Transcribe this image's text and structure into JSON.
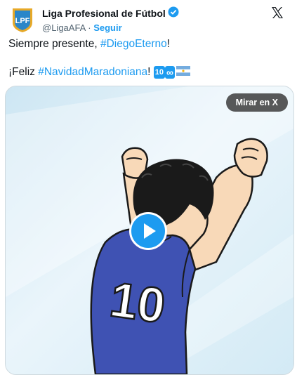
{
  "account": {
    "display_name": "Liga Profesional de Fútbol",
    "handle": "@LigaAFA",
    "separator": "·",
    "follow_label": "Seguir",
    "logo_text": "LPF"
  },
  "tweet": {
    "line1_text": "Siempre presente, ",
    "line1_hashtag": "#DiegoEterno",
    "line1_end": "!",
    "line2_text": "¡Feliz ",
    "line2_hashtag": "#NavidadMaradoniana",
    "line2_end": "! ",
    "emoji_ten": "10",
    "emoji_infinity": "∞"
  },
  "media": {
    "open_label": "Mirar en X",
    "jersey_number": "10"
  },
  "colors": {
    "accent": "#1d9bf0",
    "text": "#0f1419",
    "muted": "#536471",
    "jersey": "#3f52b3",
    "sky": "#d7ecf6"
  },
  "icons": {
    "verified": "verified-badge-icon",
    "x_logo": "x-logo-icon",
    "play": "play-icon",
    "flag": "argentina-flag-icon"
  }
}
